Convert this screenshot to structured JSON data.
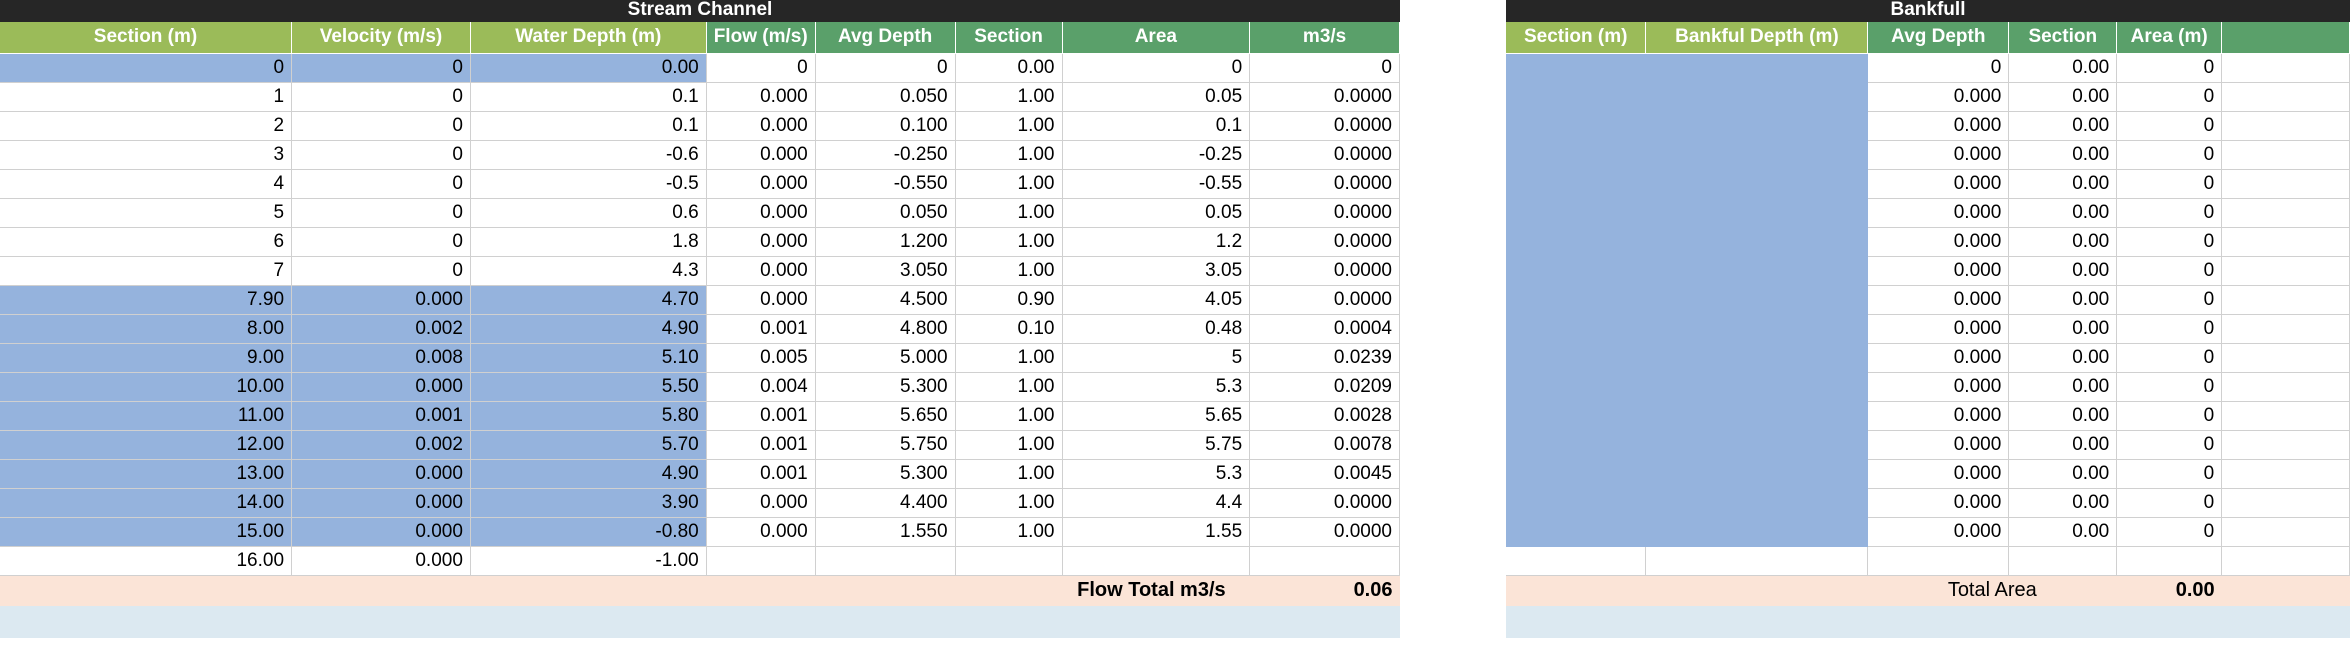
{
  "stream": {
    "title": "Stream Channel",
    "headers": [
      "Section (m)",
      "Velocity (m/s)",
      "Water Depth (m)",
      "Flow (m/s)",
      "Avg Depth",
      "Section",
      "Area",
      "m3/s"
    ],
    "rows": [
      [
        "0",
        "0",
        "0.00",
        "0",
        "0",
        "0.00",
        "0",
        "0"
      ],
      [
        "1",
        "0",
        "0.1",
        "0.000",
        "0.050",
        "1.00",
        "0.05",
        "0.0000"
      ],
      [
        "2",
        "0",
        "0.1",
        "0.000",
        "0.100",
        "1.00",
        "0.1",
        "0.0000"
      ],
      [
        "3",
        "0",
        "-0.6",
        "0.000",
        "-0.250",
        "1.00",
        "-0.25",
        "0.0000"
      ],
      [
        "4",
        "0",
        "-0.5",
        "0.000",
        "-0.550",
        "1.00",
        "-0.55",
        "0.0000"
      ],
      [
        "5",
        "0",
        "0.6",
        "0.000",
        "0.050",
        "1.00",
        "0.05",
        "0.0000"
      ],
      [
        "6",
        "0",
        "1.8",
        "0.000",
        "1.200",
        "1.00",
        "1.2",
        "0.0000"
      ],
      [
        "7",
        "0",
        "4.3",
        "0.000",
        "3.050",
        "1.00",
        "3.05",
        "0.0000"
      ],
      [
        "7.90",
        "0.000",
        "4.70",
        "0.000",
        "4.500",
        "0.90",
        "4.05",
        "0.0000"
      ],
      [
        "8.00",
        "0.002",
        "4.90",
        "0.001",
        "4.800",
        "0.10",
        "0.48",
        "0.0004"
      ],
      [
        "9.00",
        "0.008",
        "5.10",
        "0.005",
        "5.000",
        "1.00",
        "5",
        "0.0239"
      ],
      [
        "10.00",
        "0.000",
        "5.50",
        "0.004",
        "5.300",
        "1.00",
        "5.3",
        "0.0209"
      ],
      [
        "11.00",
        "0.001",
        "5.80",
        "0.001",
        "5.650",
        "1.00",
        "5.65",
        "0.0028"
      ],
      [
        "12.00",
        "0.002",
        "5.70",
        "0.001",
        "5.750",
        "1.00",
        "5.75",
        "0.0078"
      ],
      [
        "13.00",
        "0.000",
        "4.90",
        "0.001",
        "5.300",
        "1.00",
        "5.3",
        "0.0045"
      ],
      [
        "14.00",
        "0.000",
        "3.90",
        "0.000",
        "4.400",
        "1.00",
        "4.4",
        "0.0000"
      ],
      [
        "15.00",
        "0.000",
        "-0.80",
        "0.000",
        "1.550",
        "1.00",
        "1.55",
        "0.0000"
      ],
      [
        "16.00",
        "0.000",
        "-1.00",
        "",
        "",
        "",
        "",
        ""
      ]
    ],
    "total_label": "Flow Total m3/s",
    "total_value": "0.06"
  },
  "bankfull": {
    "title": "Bankfull",
    "headers": [
      "Section (m)",
      "Bankful Depth (m)",
      "Avg Depth",
      "Section",
      "Area (m)",
      ""
    ],
    "rows": [
      [
        "",
        "",
        "0",
        "0.00",
        "0",
        ""
      ],
      [
        "",
        "",
        "0.000",
        "0.00",
        "0",
        ""
      ],
      [
        "",
        "",
        "0.000",
        "0.00",
        "0",
        ""
      ],
      [
        "",
        "",
        "0.000",
        "0.00",
        "0",
        ""
      ],
      [
        "",
        "",
        "0.000",
        "0.00",
        "0",
        ""
      ],
      [
        "",
        "",
        "0.000",
        "0.00",
        "0",
        ""
      ],
      [
        "",
        "",
        "0.000",
        "0.00",
        "0",
        ""
      ],
      [
        "",
        "",
        "0.000",
        "0.00",
        "0",
        ""
      ],
      [
        "",
        "",
        "0.000",
        "0.00",
        "0",
        ""
      ],
      [
        "",
        "",
        "0.000",
        "0.00",
        "0",
        ""
      ],
      [
        "",
        "",
        "0.000",
        "0.00",
        "0",
        ""
      ],
      [
        "",
        "",
        "0.000",
        "0.00",
        "0",
        ""
      ],
      [
        "",
        "",
        "0.000",
        "0.00",
        "0",
        ""
      ],
      [
        "",
        "",
        "0.000",
        "0.00",
        "0",
        ""
      ],
      [
        "",
        "",
        "0.000",
        "0.00",
        "0",
        ""
      ],
      [
        "",
        "",
        "0.000",
        "0.00",
        "0",
        ""
      ],
      [
        "",
        "",
        "0.000",
        "0.00",
        "0",
        ""
      ],
      [
        "",
        "",
        "",
        "",
        "",
        ""
      ]
    ],
    "total_label": "Total Area",
    "total_value": "0.00"
  }
}
